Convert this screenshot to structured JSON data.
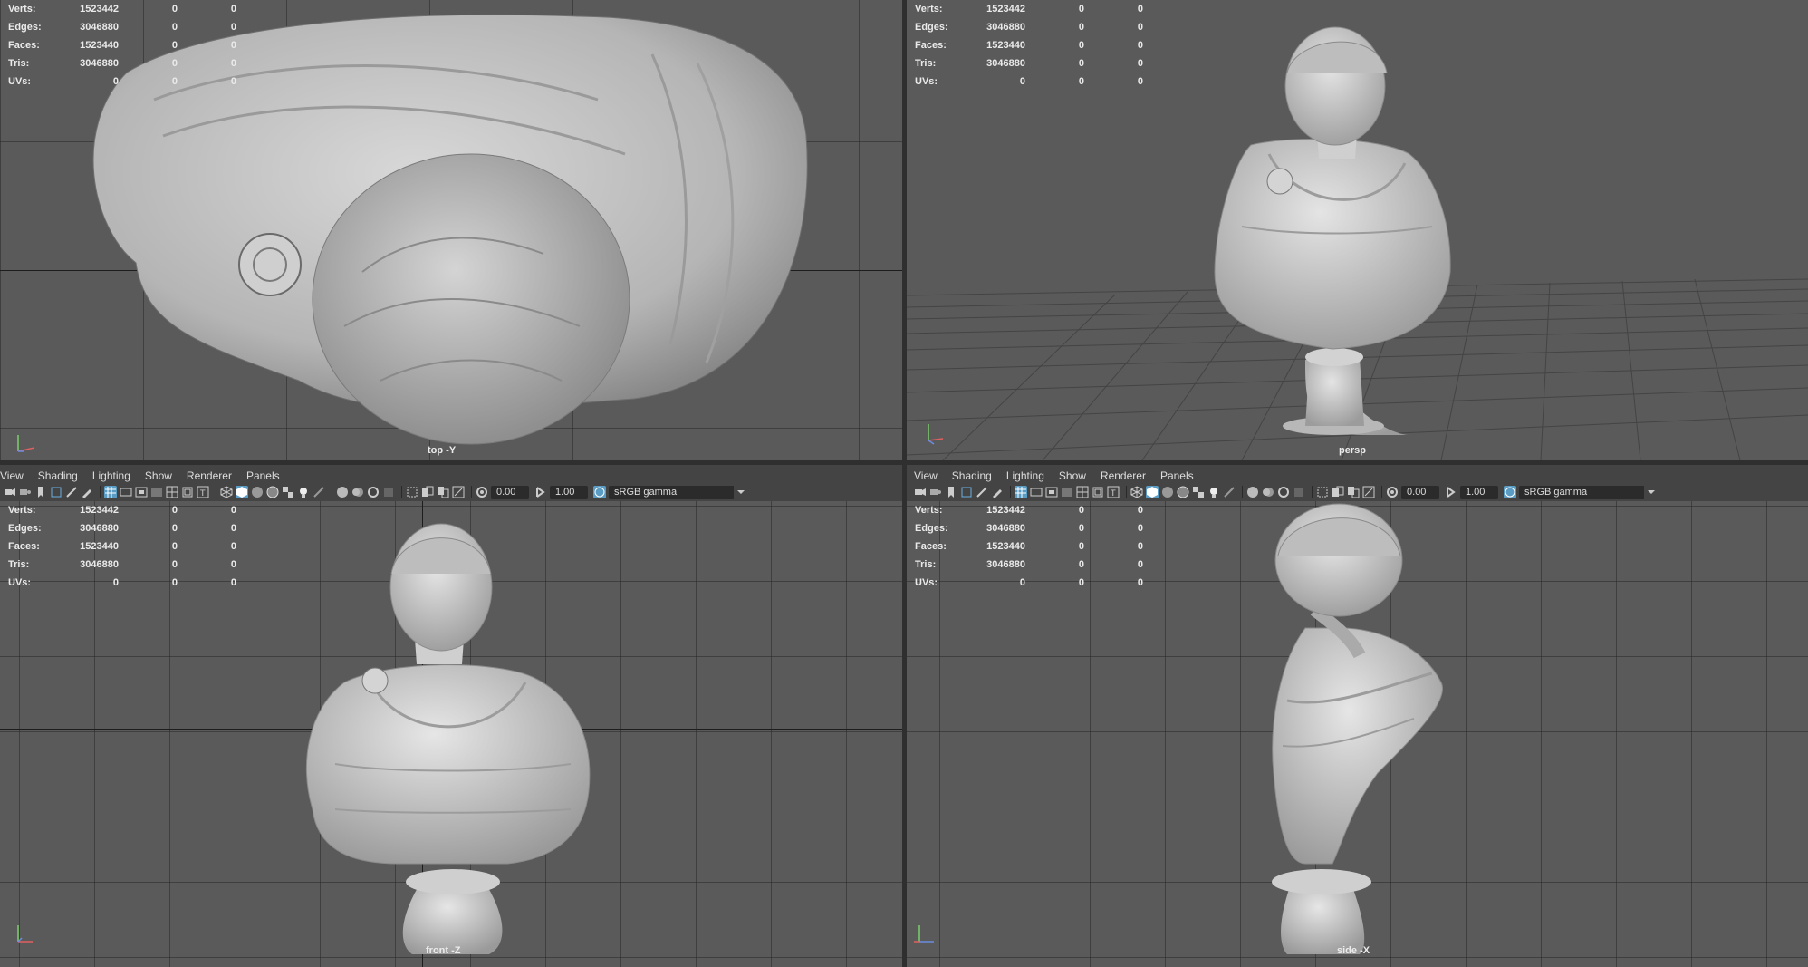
{
  "stats": {
    "labels": [
      "Verts:",
      "Edges:",
      "Faces:",
      "Tris:",
      "UVs:"
    ],
    "values": [
      [
        "1523442",
        "0",
        "0"
      ],
      [
        "3046880",
        "0",
        "0"
      ],
      [
        "1523440",
        "0",
        "0"
      ],
      [
        "3046880",
        "0",
        "0"
      ],
      [
        "0",
        "0",
        "0"
      ]
    ]
  },
  "viewports": {
    "top": {
      "camera": "top -Y"
    },
    "persp": {
      "camera": "persp"
    },
    "front": {
      "camera": "front -Z"
    },
    "side": {
      "camera": "side -X"
    }
  },
  "menu": [
    "View",
    "Shading",
    "Lighting",
    "Show",
    "Renderer",
    "Panels"
  ],
  "toolbar": {
    "exposure": "0.00",
    "gamma_value": "1.00",
    "color_space": "sRGB gamma"
  },
  "colors": {
    "viewport_bg": "#5a5a5a",
    "accent": "#5a9cc4",
    "model": "#c9c9c9"
  }
}
